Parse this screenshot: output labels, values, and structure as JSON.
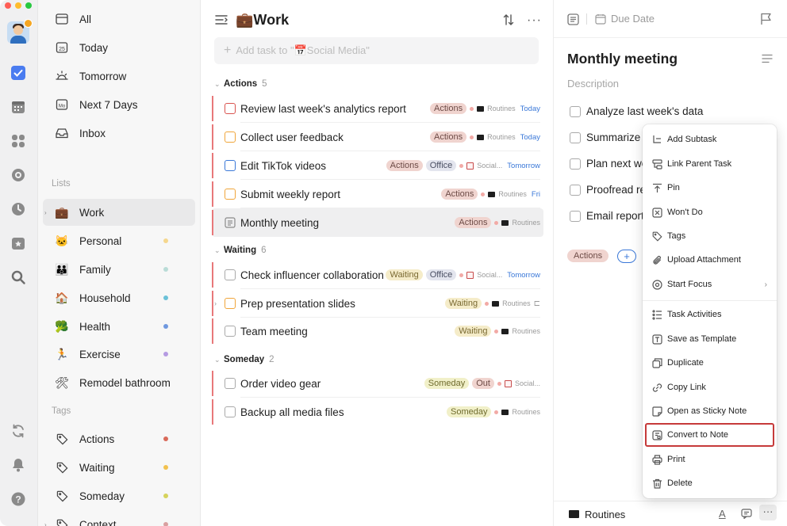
{
  "rail": {
    "traffic_colors": [
      "#ff5f57",
      "#febc2e",
      "#28c840"
    ],
    "icons": [
      "tasks-icon",
      "calendar-icon",
      "matrix-icon",
      "focus-icon",
      "habit-icon",
      "calendar-star-icon",
      "search-icon",
      "sync-icon",
      "bell-icon",
      "help-icon"
    ]
  },
  "sidebar": {
    "smart_lists": [
      {
        "label": "All",
        "icon": "all-icon"
      },
      {
        "label": "Today",
        "icon": "today-icon"
      },
      {
        "label": "Tomorrow",
        "icon": "tomorrow-icon"
      },
      {
        "label": "Next 7 Days",
        "icon": "next-7-days-icon"
      },
      {
        "label": "Inbox",
        "icon": "inbox-icon"
      }
    ],
    "lists_header": "Lists",
    "lists": [
      {
        "label": "Work",
        "emoji": "💼",
        "active": true
      },
      {
        "label": "Personal",
        "emoji": "🐱",
        "dot": "#f5d78e"
      },
      {
        "label": "Family",
        "emoji": "👪",
        "dot": "#b9dcd7"
      },
      {
        "label": "Household",
        "emoji": "🏠",
        "dot": "#6bc1d8"
      },
      {
        "label": "Health",
        "emoji": "🥦",
        "dot": "#6f98df"
      },
      {
        "label": "Exercise",
        "emoji": "🏃",
        "dot": "#b59be2"
      },
      {
        "label": "Remodel bathroom",
        "emoji": "🛠"
      }
    ],
    "tags_header": "Tags",
    "tags": [
      {
        "label": "Actions",
        "dot": "#d96a5a"
      },
      {
        "label": "Waiting",
        "dot": "#f2c14e"
      },
      {
        "label": "Someday",
        "dot": "#d6d35c"
      },
      {
        "label": "Context",
        "dot": "#d9a0a0"
      }
    ]
  },
  "tasks": {
    "title": "💼Work",
    "add_placeholder": "Add task to \"📅Social Media\"",
    "groups": [
      {
        "name": "Actions",
        "count": "5"
      },
      {
        "name": "Waiting",
        "count": "6"
      },
      {
        "name": "Someday",
        "count": "2"
      }
    ],
    "items": [
      {
        "title": "Review last week's analytics report",
        "tags": [
          "Actions"
        ],
        "project": "Routines",
        "date": "Today",
        "edge": "#e8787a",
        "cb": "#d9534f"
      },
      {
        "title": "Collect user feedback",
        "tags": [
          "Actions"
        ],
        "project": "Routines",
        "date": "Today",
        "edge": "#e8787a",
        "cb": "#f0a53a"
      },
      {
        "title": "Edit TikTok videos",
        "tags": [
          "Actions",
          "Office"
        ],
        "project": "Social...",
        "date": "Tomorrow",
        "edge": "#e8787a",
        "cb": "#3a78d8"
      },
      {
        "title": "Submit weekly report",
        "tags": [
          "Actions"
        ],
        "project": "Routines",
        "date": "Fri",
        "edge": "#e8787a",
        "cb": "#f0a53a"
      },
      {
        "title": "Monthly meeting",
        "tags": [
          "Actions"
        ],
        "project": "Routines",
        "date": "",
        "edge": "#e8787a",
        "cb": "#a9a9a9"
      },
      {
        "title": "Check influencer collaboration",
        "tags": [
          "Waiting",
          "Office"
        ],
        "project": "Social...",
        "date": "Tomorrow",
        "edge": "#e8787a",
        "cb": "#a9a9a9"
      },
      {
        "title": "Prep presentation slides",
        "tags": [
          "Waiting"
        ],
        "project": "Routines",
        "date": "",
        "edge": "#e8787a",
        "cb": "#f0a53a"
      },
      {
        "title": "Team meeting",
        "tags": [
          "Waiting"
        ],
        "project": "Routines",
        "date": "",
        "edge": "#e8787a",
        "cb": "#a9a9a9"
      },
      {
        "title": "Order video gear",
        "tags": [
          "Someday",
          "Out"
        ],
        "project": "Social...",
        "date": "",
        "edge": "#e8787a",
        "cb": "#a9a9a9"
      },
      {
        "title": "Backup all media files",
        "tags": [
          "Someday"
        ],
        "project": "Routines",
        "date": "",
        "edge": "#e8787a",
        "cb": "#a9a9a9"
      }
    ]
  },
  "detail": {
    "due_label": "Due Date",
    "title": "Monthly meeting",
    "description_placeholder": "Description",
    "subtasks": [
      "Analyze last week's data",
      "Summarize t",
      "Plan next we",
      "Proofread re",
      "Email report"
    ],
    "tag": "Actions",
    "add_tag": "+",
    "project": "Routines"
  },
  "menu": {
    "items": [
      {
        "label": "Add Subtask",
        "icon": "subtask-icon"
      },
      {
        "label": "Link Parent Task",
        "icon": "link-parent-icon"
      },
      {
        "label": "Pin",
        "icon": "pin-icon"
      },
      {
        "label": "Won't Do",
        "icon": "wont-do-icon"
      },
      {
        "label": "Tags",
        "icon": "tag-icon"
      },
      {
        "label": "Upload Attachment",
        "icon": "attachment-icon"
      },
      {
        "label": "Start Focus",
        "icon": "focus-icon",
        "submenu": true
      },
      {
        "label": "Task Activities",
        "icon": "activities-icon"
      },
      {
        "label": "Save as Template",
        "icon": "template-icon"
      },
      {
        "label": "Duplicate",
        "icon": "duplicate-icon"
      },
      {
        "label": "Copy Link",
        "icon": "link-icon"
      },
      {
        "label": "Open as Sticky Note",
        "icon": "sticky-note-icon"
      },
      {
        "label": "Convert to Note",
        "icon": "convert-note-icon",
        "highlighted": true
      },
      {
        "label": "Print",
        "icon": "print-icon"
      },
      {
        "label": "Delete",
        "icon": "trash-icon"
      }
    ],
    "highlight_color": "#c63a3a"
  }
}
